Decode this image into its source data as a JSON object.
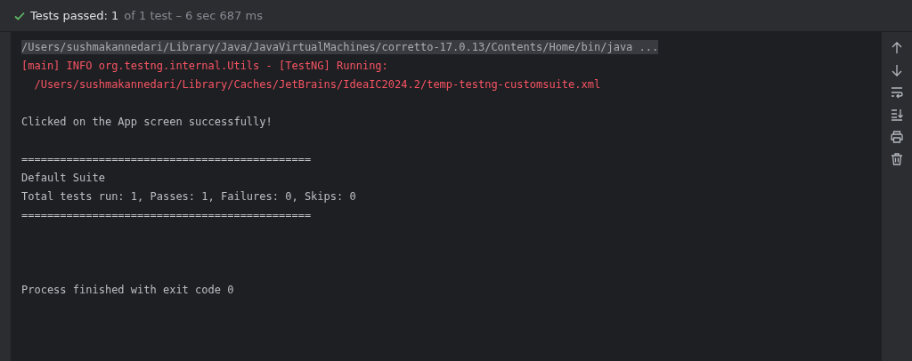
{
  "header": {
    "status": "Tests passed: 1",
    "detail": "of 1 test – 6 sec 687 ms"
  },
  "console": {
    "blocks": [
      {
        "kind": "normal",
        "lines": [
          {
            "kind": "command",
            "text": "/Users/sushmakannedari/Library/Java/JavaVirtualMachines/corretto-17.0.13/Contents/Home/bin/java ..."
          },
          {
            "kind": "error",
            "text": "[main] INFO org.testng.internal.Utils - [TestNG] Running:"
          },
          {
            "kind": "error",
            "text": "  /Users/sushmakannedari/Library/Caches/JetBrains/IdeaIC2024.2/temp-testng-customsuite.xml"
          }
        ]
      },
      {
        "kind": "normal",
        "lines": [
          {
            "kind": "output",
            "text": "Clicked on the App screen successfully!"
          }
        ]
      },
      {
        "kind": "normal",
        "lines": [
          {
            "kind": "output",
            "text": "============================================="
          },
          {
            "kind": "output",
            "text": "Default Suite"
          },
          {
            "kind": "output",
            "text": "Total tests run: 1, Passes: 1, Failures: 0, Skips: 0"
          },
          {
            "kind": "output",
            "text": "============================================="
          }
        ]
      },
      {
        "kind": "final",
        "lines": [
          {
            "kind": "output",
            "text": "Process finished with exit code 0"
          }
        ]
      }
    ]
  }
}
